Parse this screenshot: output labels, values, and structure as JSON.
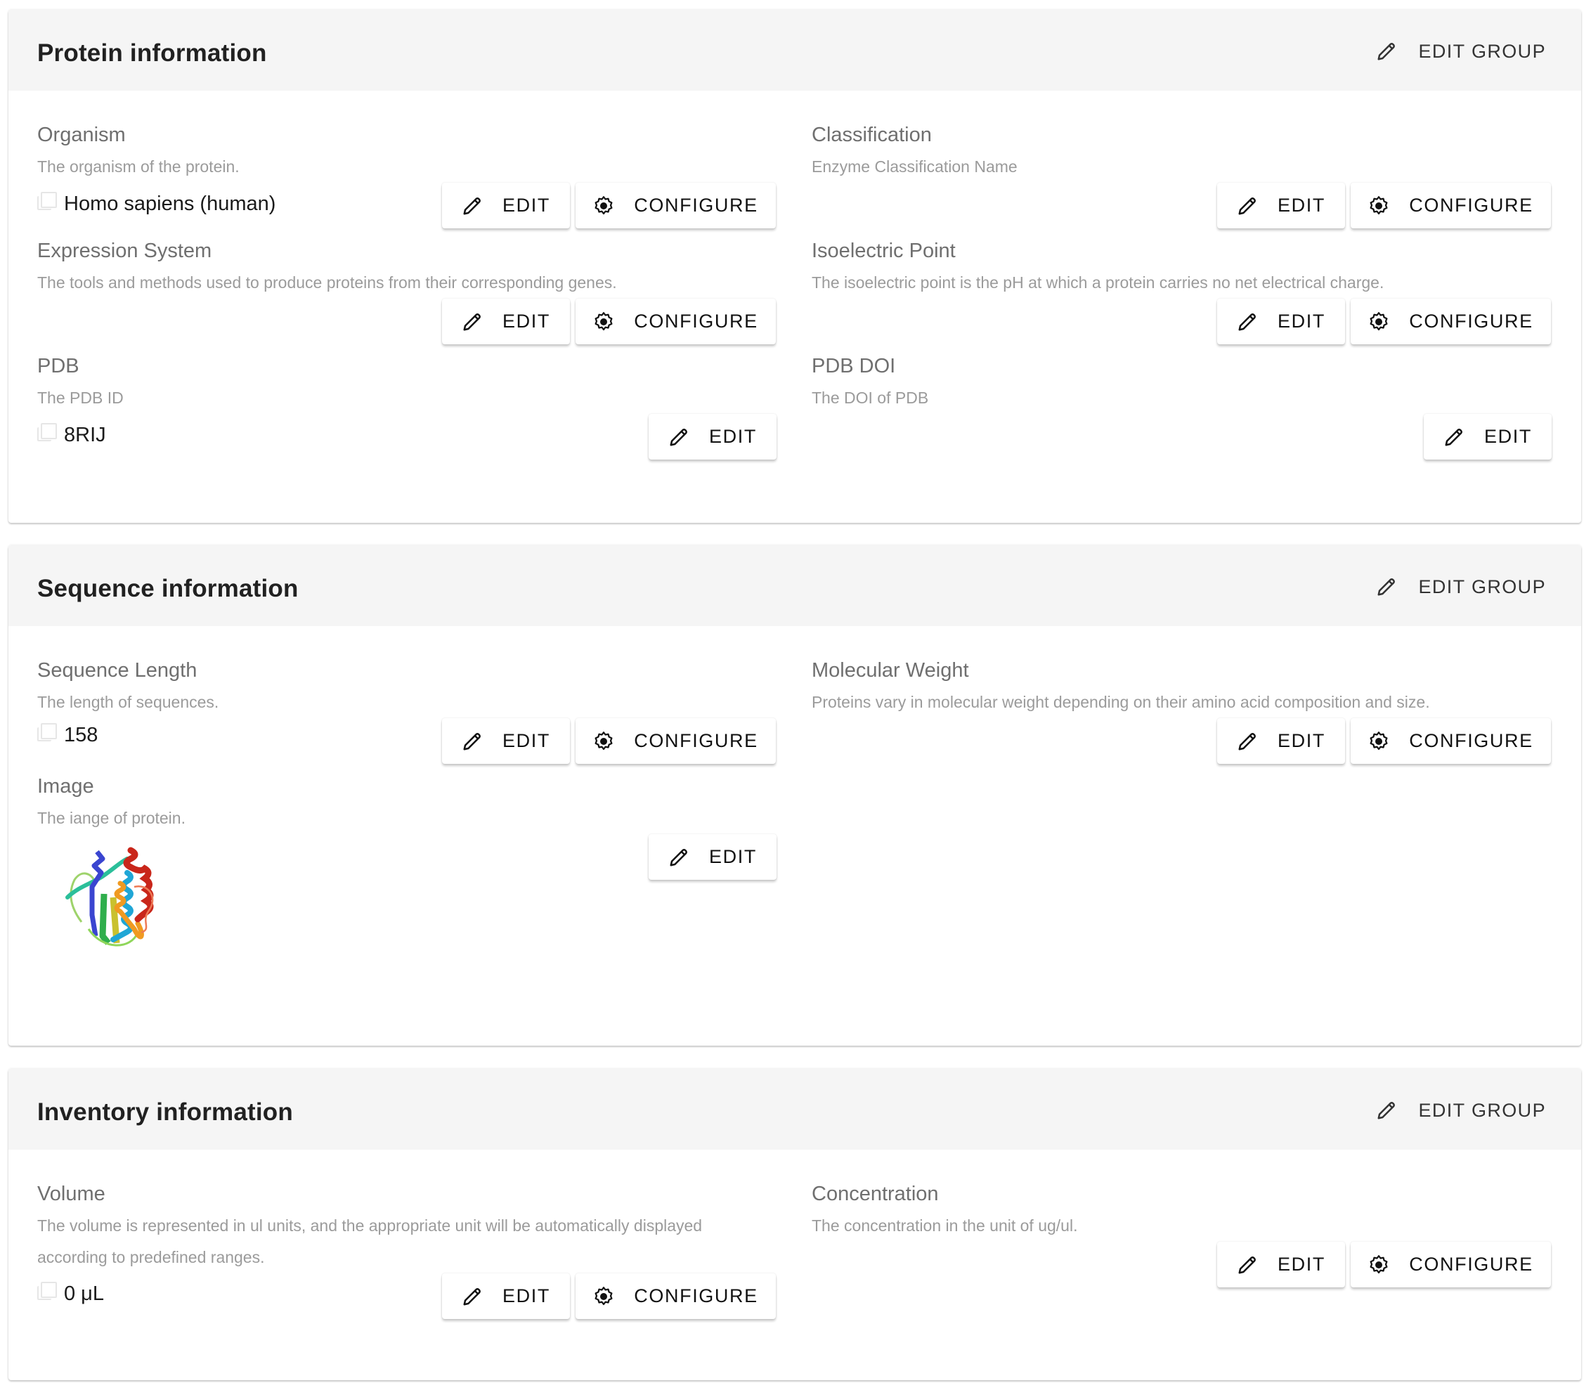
{
  "buttons": {
    "edit_group": "EDIT GROUP",
    "edit": "EDIT",
    "configure": "CONFIGURE"
  },
  "icons": {
    "edit": "pencil-icon",
    "configure": "gear-icon",
    "copy": "copy-icon"
  },
  "colors": {
    "header_bg": "#f5f5f5",
    "title": "#212121",
    "label": "#6f6f6f",
    "description": "#9b9b9b",
    "value": "#1a1a1a"
  },
  "groups": [
    {
      "title": "Protein information",
      "fields": [
        {
          "label": "Organism",
          "description": "The organism of the protein.",
          "value": "Homo sapiens (human)",
          "actions": [
            "edit",
            "configure"
          ]
        },
        {
          "label": "Classification",
          "description": "Enzyme Classification Name",
          "value": null,
          "actions": [
            "edit",
            "configure"
          ]
        },
        {
          "label": "Expression System",
          "description": "The tools and methods used to produce proteins from their corresponding genes.",
          "value": null,
          "actions": [
            "edit",
            "configure"
          ]
        },
        {
          "label": "Isoelectric Point",
          "description": "The isoelectric point is the pH at which a protein carries no net electrical charge.",
          "value": null,
          "actions": [
            "edit",
            "configure"
          ]
        },
        {
          "label": "PDB",
          "description": "The PDB ID",
          "value": "8RIJ",
          "actions": [
            "edit"
          ]
        },
        {
          "label": "PDB DOI",
          "description": "The DOI of PDB",
          "value": null,
          "actions": [
            "edit"
          ]
        }
      ]
    },
    {
      "title": "Sequence information",
      "fields": [
        {
          "label": "Sequence Length",
          "description": "The length of sequences.",
          "value": "158",
          "actions": [
            "edit",
            "configure"
          ]
        },
        {
          "label": "Molecular Weight",
          "description": "Proteins vary in molecular weight depending on their amino acid composition and size.",
          "value": null,
          "actions": [
            "edit",
            "configure"
          ]
        },
        {
          "label": "Image",
          "description": "The iange of protein.",
          "value": "protein-structure-image",
          "actions": [
            "edit"
          ]
        }
      ]
    },
    {
      "title": "Inventory information",
      "fields": [
        {
          "label": "Volume",
          "description": "The volume is represented in ul units, and the appropriate unit will be automatically displayed according to predefined ranges.",
          "value": "0 μL",
          "actions": [
            "edit",
            "configure"
          ]
        },
        {
          "label": "Concentration",
          "description": "The concentration in the unit of ug/ul.",
          "value": null,
          "actions": [
            "edit",
            "configure"
          ]
        }
      ]
    }
  ]
}
